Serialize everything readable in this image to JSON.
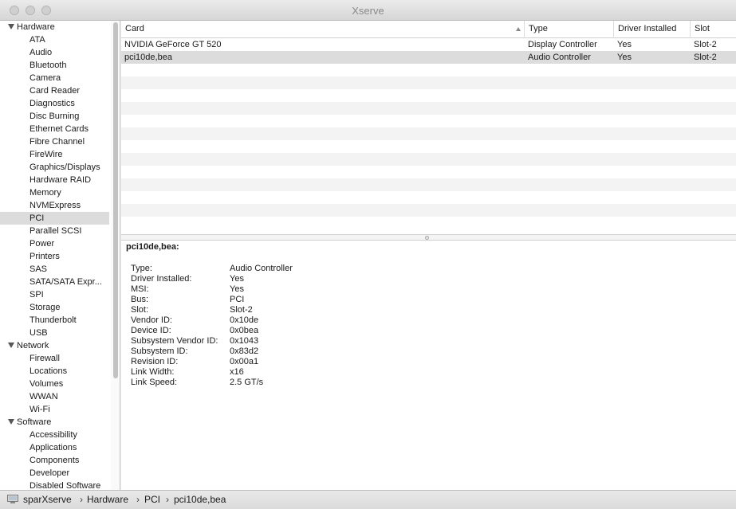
{
  "window": {
    "title": "Xserve"
  },
  "sidebar": {
    "sections": [
      {
        "label": "Hardware",
        "items": [
          "ATA",
          "Audio",
          "Bluetooth",
          "Camera",
          "Card Reader",
          "Diagnostics",
          "Disc Burning",
          "Ethernet Cards",
          "Fibre Channel",
          "FireWire",
          "Graphics/Displays",
          "Hardware RAID",
          "Memory",
          "NVMExpress",
          "PCI",
          "Parallel SCSI",
          "Power",
          "Printers",
          "SAS",
          "SATA/SATA Expr...",
          "SPI",
          "Storage",
          "Thunderbolt",
          "USB"
        ]
      },
      {
        "label": "Network",
        "items": [
          "Firewall",
          "Locations",
          "Volumes",
          "WWAN",
          "Wi-Fi"
        ]
      },
      {
        "label": "Software",
        "items": [
          "Accessibility",
          "Applications",
          "Components",
          "Developer",
          "Disabled Software"
        ]
      }
    ],
    "selected": "PCI"
  },
  "table": {
    "columns": [
      "Card",
      "Type",
      "Driver Installed",
      "Slot"
    ],
    "rows": [
      [
        "NVIDIA GeForce GT 520",
        "Display Controller",
        "Yes",
        "Slot-2"
      ],
      [
        "pci10de,bea",
        "Audio Controller",
        "Yes",
        "Slot-2"
      ]
    ],
    "selected_row": 1
  },
  "detail": {
    "title": "pci10de,bea:",
    "fields": [
      [
        "Type:",
        "Audio Controller"
      ],
      [
        "Driver Installed:",
        "Yes"
      ],
      [
        "MSI:",
        "Yes"
      ],
      [
        "Bus:",
        "PCI"
      ],
      [
        "Slot:",
        "Slot-2"
      ],
      [
        "Vendor ID:",
        "0x10de"
      ],
      [
        "Device ID:",
        "0x0bea"
      ],
      [
        "Subsystem Vendor ID:",
        "0x1043"
      ],
      [
        "Subsystem ID:",
        "0x83d2"
      ],
      [
        "Revision ID:",
        "0x00a1"
      ],
      [
        "Link Width:",
        "x16"
      ],
      [
        "Link Speed:",
        "2.5 GT/s"
      ]
    ]
  },
  "statusbar": {
    "path": [
      "sparXserve",
      "Hardware",
      "PCI",
      "pci10de,bea"
    ],
    "separator": "›"
  }
}
